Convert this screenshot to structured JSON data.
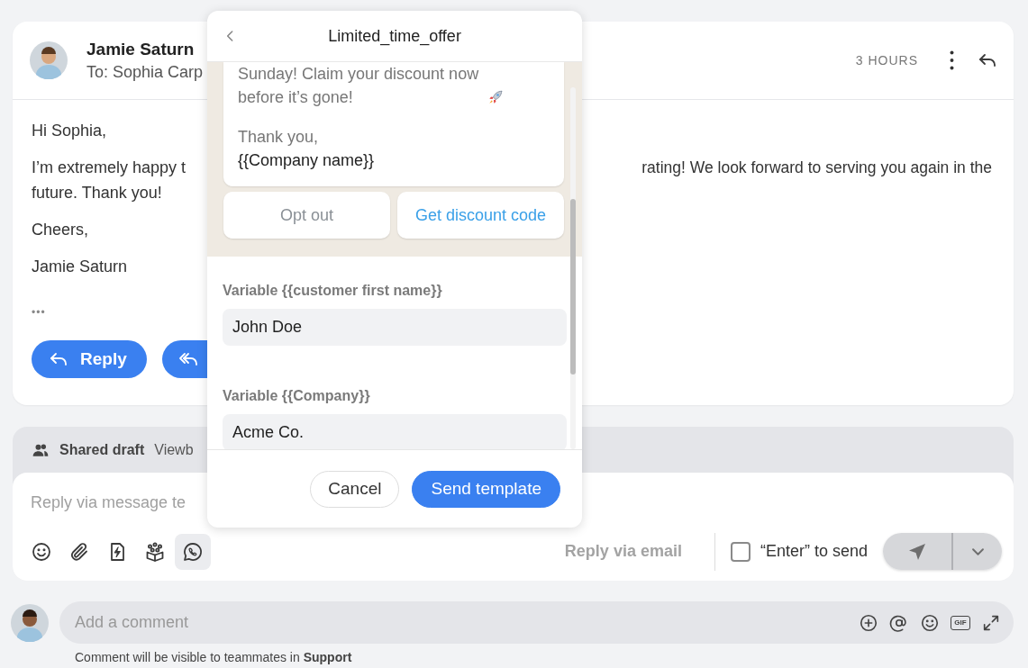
{
  "email": {
    "sender": "Jamie Saturn",
    "recipient": "To: Sophia Carp",
    "time": "3 HOURS",
    "body": [
      {
        "lines": [
          [
            "Hi Sophia,"
          ]
        ]
      },
      {
        "lines": [
          [
            "I’m extremely happy t",
            "rating! We look forward to serving you again in the"
          ],
          [
            "future. Thank you!"
          ]
        ]
      },
      {
        "lines": [
          [
            "Cheers,"
          ]
        ]
      },
      {
        "lines": [
          [
            "Jamie Saturn"
          ]
        ]
      }
    ],
    "more": "•••",
    "buttons": [
      {
        "kind": "reply",
        "label": "Reply"
      },
      {
        "kind": "reply_all"
      }
    ]
  },
  "draft": {
    "title": "Shared draft",
    "viewers": "Viewb",
    "placeholder": "Reply via message te",
    "tools": [
      {
        "kind": "emoji",
        "selected": false
      },
      {
        "kind": "attach",
        "selected": false
      },
      {
        "kind": "shortcut",
        "selected": false
      },
      {
        "kind": "apps",
        "selected": false
      },
      {
        "kind": "whatsapp",
        "selected": true
      }
    ],
    "switch_link": "Reply via email",
    "enter_to_send": {
      "label": "“Enter” to send",
      "checked": false
    },
    "send_disabled": true
  },
  "template_popup": {
    "title": "Limited_time_offer",
    "message": "Sunday! Claim your discount now before it’s gone!",
    "sign_off": "Thank you,",
    "signature": "{{Company name}}",
    "quick_replies": [
      {
        "kind": "plain",
        "label": "Opt out"
      },
      {
        "kind": "link",
        "label": "Get discount code"
      }
    ],
    "variables": [
      {
        "label": "Variable {{customer first name}}",
        "value": "John Doe"
      },
      {
        "label": "Variable {{Company}}",
        "value": "Acme Co."
      }
    ],
    "buttons": [
      {
        "kind": "secondary",
        "label": "Cancel"
      },
      {
        "kind": "primary",
        "label": "Send template"
      }
    ]
  },
  "comment": {
    "placeholder": "Add a comment",
    "tools": [
      {
        "kind": "plus"
      },
      {
        "kind": "mention"
      },
      {
        "kind": "emoji"
      },
      {
        "kind": "gif",
        "label": "GIF"
      },
      {
        "kind": "expand"
      }
    ],
    "note": "Comment will be visible to teammates in **Support**"
  }
}
